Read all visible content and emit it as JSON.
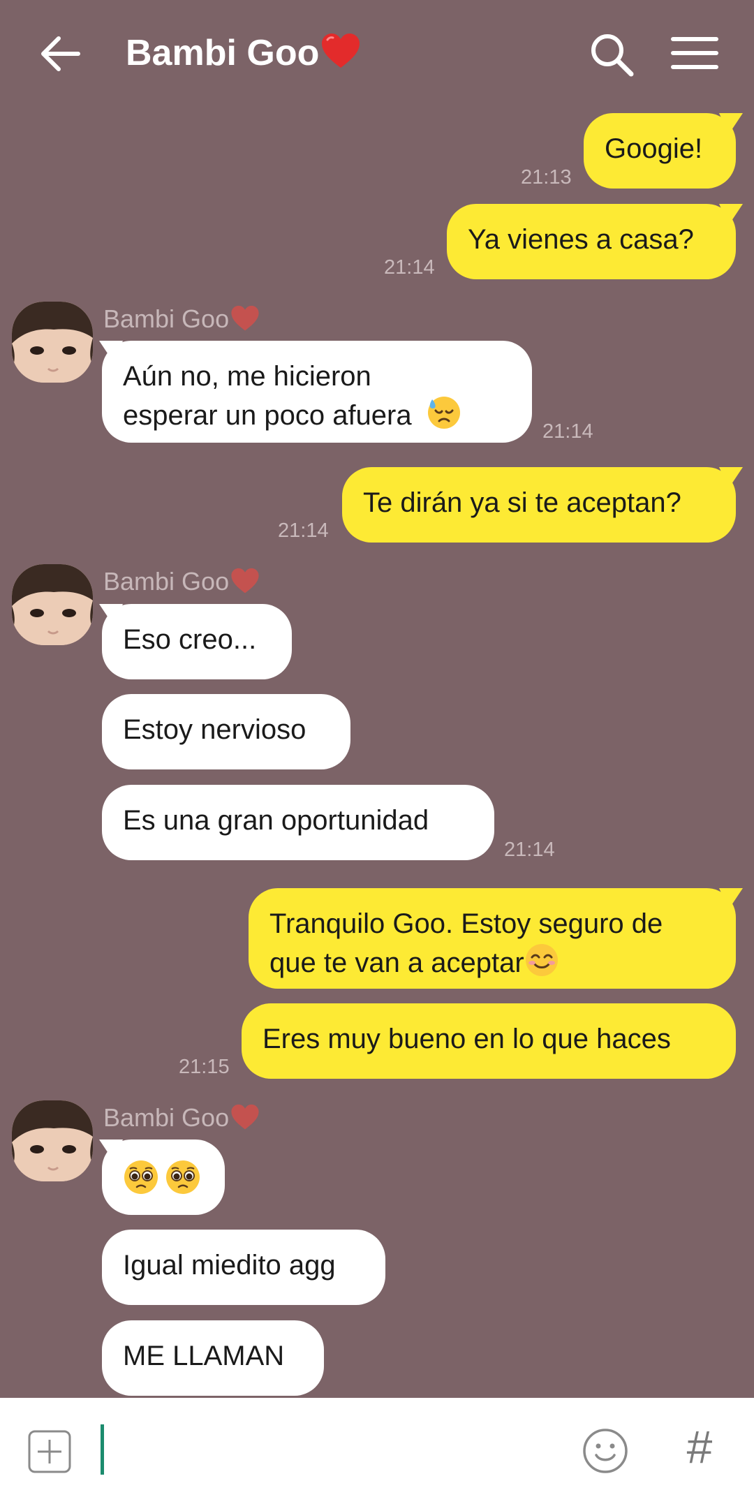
{
  "header": {
    "title": "Bambi Goo",
    "title_emoji": "heart-icon"
  },
  "messages": [
    {
      "side": "out",
      "text": "Googie!",
      "time": "21:13"
    },
    {
      "side": "out",
      "text": "Ya vienes a casa?",
      "time": "21:14"
    },
    {
      "side": "in",
      "sender": "Bambi Goo",
      "lines": [
        "Aún no, me hicieron",
        "esperar un poco afuera"
      ],
      "emoji": "downcast-sweat-emoji",
      "time": "21:14"
    },
    {
      "side": "out",
      "text": "Te dirán ya si te aceptan?",
      "time": "21:14"
    },
    {
      "side": "in",
      "sender": "Bambi Goo",
      "text": "Eso creo..."
    },
    {
      "side": "in",
      "text": "Estoy nervioso"
    },
    {
      "side": "in",
      "text": "Es una gran oportunidad",
      "time": "21:14"
    },
    {
      "side": "out",
      "lines": [
        "Tranquilo Goo. Estoy seguro de",
        "que te van a aceptar"
      ],
      "emoji": "smiling-blush-emoji"
    },
    {
      "side": "out",
      "text": "Eres muy bueno en lo que haces",
      "time": "21:15"
    },
    {
      "side": "in",
      "sender": "Bambi Goo",
      "emoji": "pleading-face-emoji x2"
    },
    {
      "side": "in",
      "text": "Igual miedito agg"
    },
    {
      "side": "in",
      "text": "ME LLAMAN"
    }
  ],
  "input_bar": {
    "plus_icon": "plus-square-icon",
    "emoji_icon": "smiley-icon",
    "hash_label": "#"
  },
  "colors": {
    "background": "#7c6367",
    "outgoing_bubble": "#fdea34",
    "incoming_bubble": "#ffffff",
    "cursor": "#1c8c6e"
  }
}
